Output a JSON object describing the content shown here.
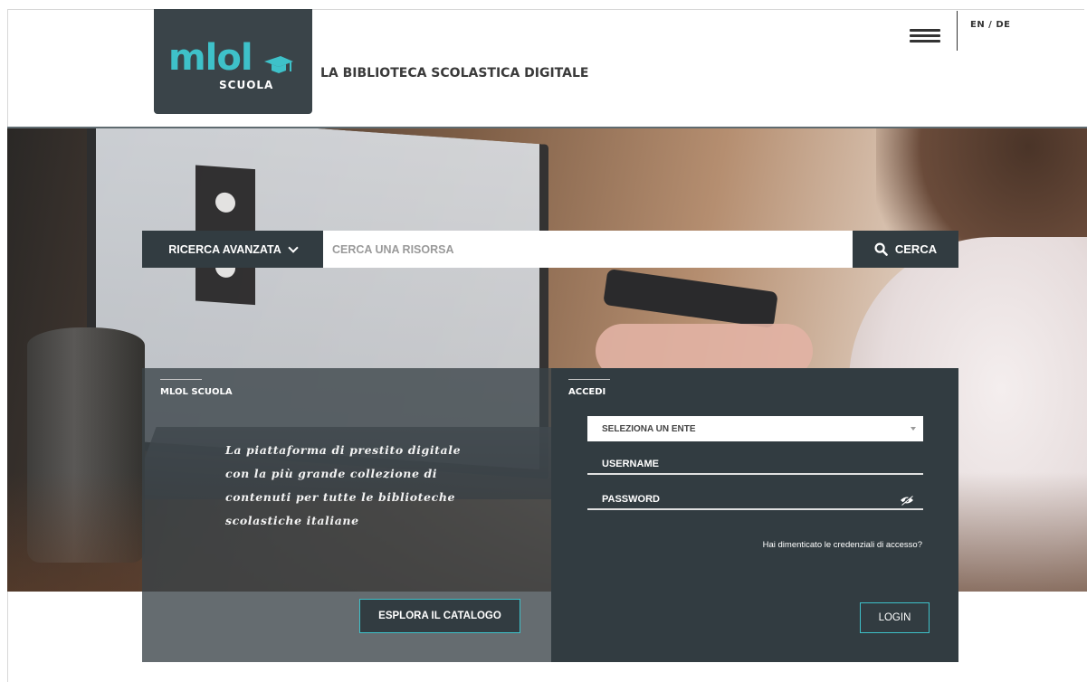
{
  "header": {
    "logo_main": "mlol",
    "logo_sub": "SCUOLA",
    "site_title": "LA BIBLIOTECA SCOLASTICA DIGITALE",
    "lang_switch": "EN / DE",
    "menu_icon": "hamburger-menu-icon"
  },
  "search": {
    "advanced_label": "RICERCA AVANZATA",
    "placeholder": "CERCA UNA RISORSA",
    "value": "",
    "button_label": "CERCA",
    "button_icon": "search-icon"
  },
  "about": {
    "title": "MLOL SCUOLA",
    "tagline_lines": [
      "La piattaforma di prestito digitale",
      "con la più grande collezione di",
      "contenuti per tutte le biblioteche",
      "scolastiche italiane"
    ],
    "explore_button": "ESPLORA IL CATALOGO"
  },
  "login": {
    "title": "ACCEDI",
    "select_ente": "SELEZIONA UN ENTE",
    "username_placeholder": "USERNAME",
    "password_placeholder": "PASSWORD",
    "password_toggle_icon": "eye-slash-icon",
    "forgot_link": "Hai dimenticato le credenziali di accesso?",
    "login_button": "LOGIN"
  },
  "colors": {
    "accent": "#3ec1c9",
    "panel_dark": "#323c41",
    "logo_bg": "#3a4449"
  }
}
